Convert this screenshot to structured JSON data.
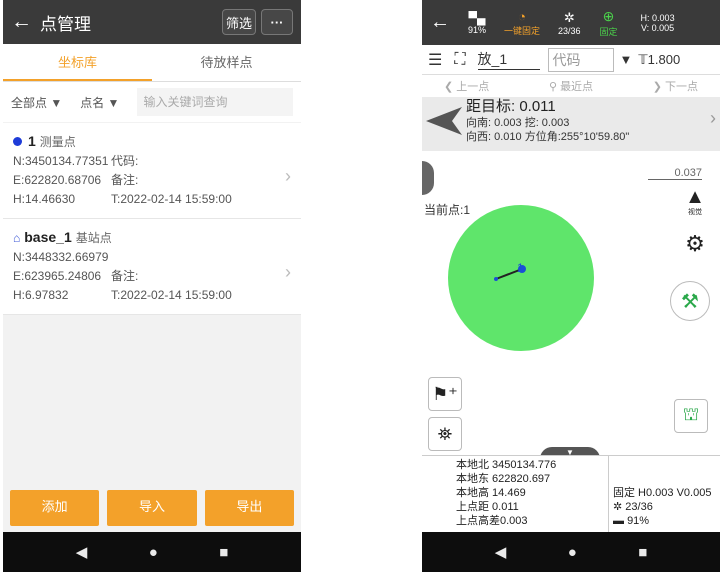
{
  "left": {
    "title": "点管理",
    "filter_btn": "筛选",
    "more_btn": "···",
    "tabs": [
      "坐标库",
      "待放样点"
    ],
    "dropdown_all": "全部点 ▼",
    "dropdown_name": "点名 ▼",
    "search_placeholder": "输入关键词查询",
    "points": [
      {
        "name": "1",
        "type": "测量点",
        "n": "N:3450134.77351",
        "code": "代码:",
        "e": "E:622820.68706",
        "note": "备注:",
        "h": "H:14.46630",
        "t": "T:2022-02-14 15:59:00"
      },
      {
        "name": "base_1",
        "type": "基站点",
        "n": "N:3448332.66979",
        "code": "",
        "e": "E:623965.24806",
        "note": "备注:",
        "h": "H:6.97832",
        "t": "T:2022-02-14 15:59:00"
      }
    ],
    "actions": [
      "添加",
      "导入",
      "导出"
    ]
  },
  "right": {
    "battery": "91%",
    "onekey": "一键固定",
    "sats": "23/36",
    "fix": "固定",
    "h_prec": "H: 0.003",
    "v_prec": "V: 0.005",
    "point_name": "放_1",
    "code_placeholder": "代码",
    "pole_height": "1.800",
    "prev": "上一点",
    "nearest": "最近点",
    "next": "下一点",
    "distance": "距目标: 0.011",
    "line1": "向南: 0.003 挖: 0.003",
    "line2": "向西: 0.010 方位角:255°10'59.80\"",
    "scale": "0.037",
    "current_point": "当前点:1",
    "view_label": "视觉",
    "marker": "1",
    "info_left": [
      "本地北  3450134.776",
      "本地东  622820.697",
      "本地高  14.469",
      "上点距  0.011",
      "上点高差0.003"
    ],
    "info_right": [
      "固定 H0.003 V0.005",
      "23/36",
      "91%"
    ]
  },
  "colors": {
    "accent": "#f3a12a",
    "header": "#3a3a3a",
    "circle": "#5fe56b",
    "fix_green": "#4bd24b"
  }
}
